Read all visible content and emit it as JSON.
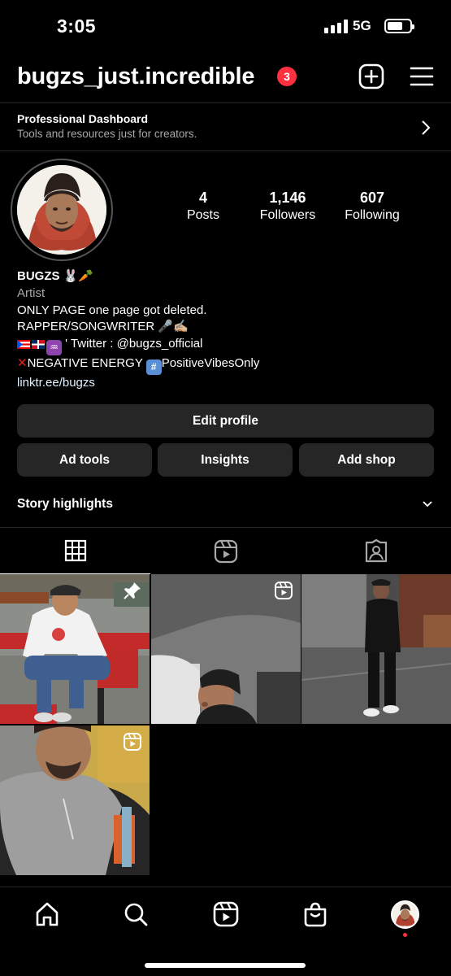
{
  "status": {
    "time": "3:05",
    "network": "5G",
    "battery_level": 0.7
  },
  "header": {
    "username": "bugzs_just.incredible",
    "notification_count": "3"
  },
  "dashboard": {
    "title": "Professional Dashboard",
    "subtitle": "Tools and resources just for creators."
  },
  "stats": {
    "posts": {
      "value": "4",
      "label": "Posts"
    },
    "followers": {
      "value": "1,146",
      "label": "Followers"
    },
    "following": {
      "value": "607",
      "label": "Following"
    }
  },
  "bio": {
    "name": "BUGZS 🐰🥕",
    "category": "Artist",
    "line1": "ONLY PAGE one page got deleted.",
    "line2": "RAPPER/SONGWRITER 🎤✍🏼",
    "line3_text": "' Twitter : @bugzs_official",
    "line4_prefix": "NEGATIVE ENERGY",
    "line4_suffix": "PositiveVibesOnly",
    "link": "linktr.ee/bugzs"
  },
  "buttons": {
    "edit_profile": "Edit profile",
    "ad_tools": "Ad tools",
    "insights": "Insights",
    "add_shop": "Add shop"
  },
  "highlights": {
    "title": "Story highlights"
  },
  "tabs": [
    "grid-icon",
    "reels-icon",
    "tagged-icon"
  ],
  "posts": [
    {
      "type": "pinned-photo",
      "icon": "pin-icon"
    },
    {
      "type": "reel",
      "icon": "reel-icon"
    },
    {
      "type": "photo",
      "icon": ""
    },
    {
      "type": "reel",
      "icon": "reel-icon"
    }
  ],
  "nav": [
    "home-icon",
    "search-icon",
    "reels-icon",
    "shop-icon",
    "profile-avatar"
  ],
  "colors": {
    "background": "#000000",
    "button": "#262626",
    "badge": "#ff3040",
    "secondary_text": "#a8a8a8"
  }
}
